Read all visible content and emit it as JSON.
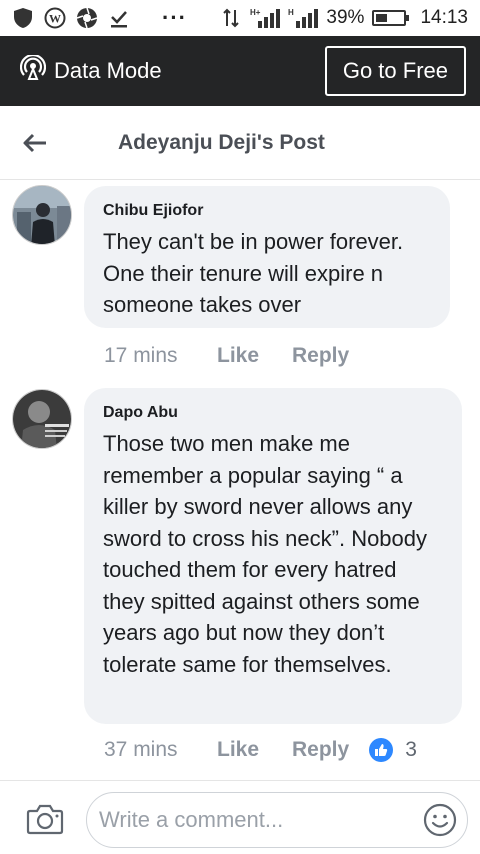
{
  "status_bar": {
    "battery": "39%",
    "battery_level": 0.39,
    "time": "14:13",
    "dots": "···"
  },
  "data_bar": {
    "mode_label": "Data Mode",
    "go_free_label": "Go to Free"
  },
  "header": {
    "title": "Adeyanju Deji's Post"
  },
  "comments": [
    {
      "author": "Chibu Ejiofor",
      "text": "They can't be in power forever. One their tenure will expire n someone takes over",
      "time": "17 mins",
      "like_label": "Like",
      "reply_label": "Reply"
    },
    {
      "author": "Dapo Abu",
      "text": "Those two men make me remember a popular saying “ a killer by sword never allows any sword to cross his neck”. Nobody touched them for every hatred they spitted against others some years ago but now they don’t tolerate same for themselves.",
      "time": "37 mins",
      "like_label": "Like",
      "reply_label": "Reply",
      "reaction_count": "3"
    }
  ],
  "composer": {
    "placeholder": "Write a comment..."
  },
  "colors": {
    "data_bar_bg": "#242526",
    "bubble_bg": "#f0f2f5",
    "like_blue": "#2d88ff",
    "meta_gray": "#8d949e"
  }
}
